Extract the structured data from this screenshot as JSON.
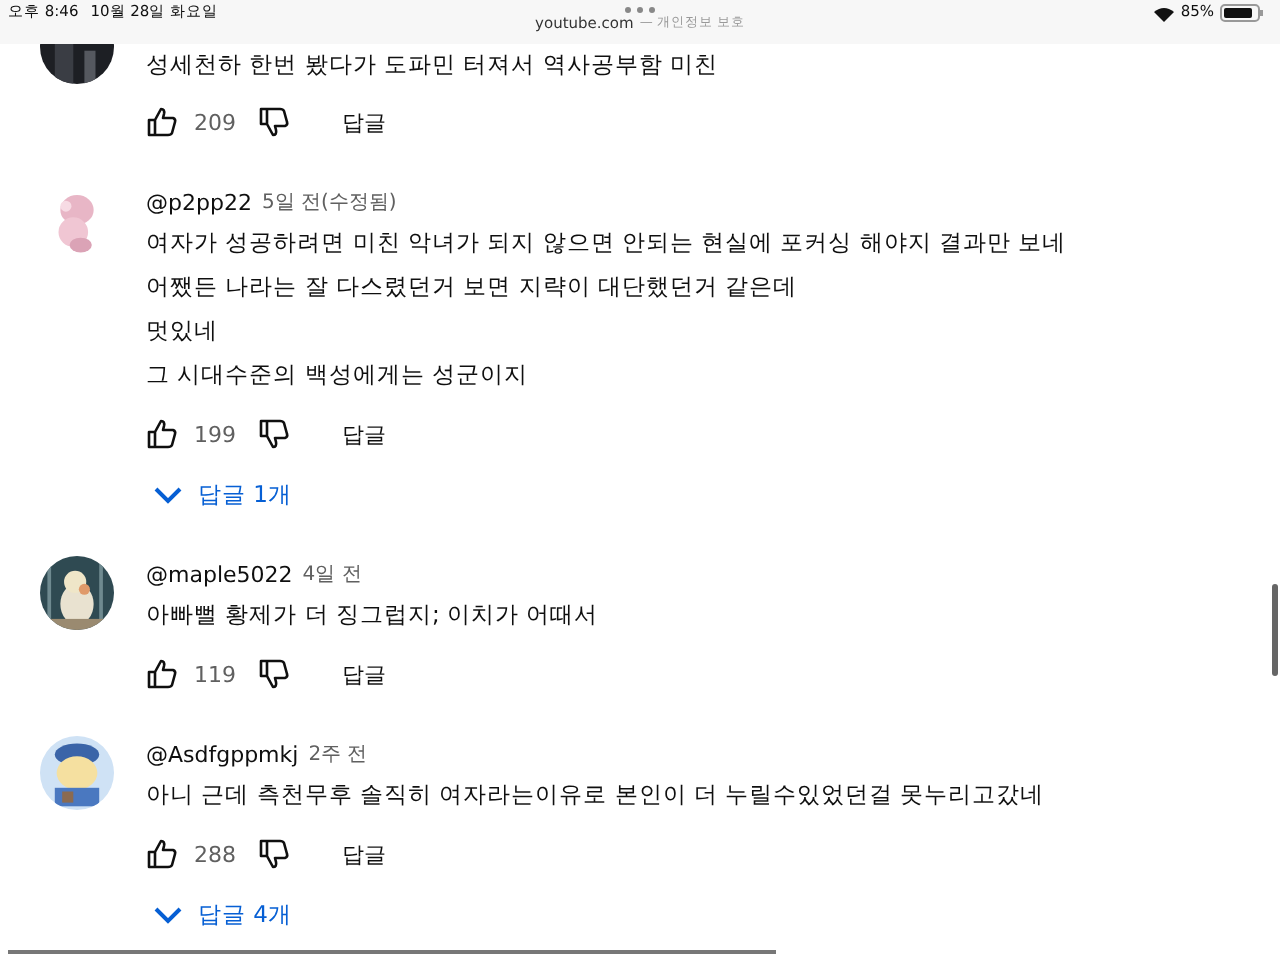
{
  "status_bar": {
    "time": "오후 8:46",
    "date": "10월 28일 화요일",
    "battery": "85%"
  },
  "address_bar": {
    "url": "youtube.com",
    "note": "— 개인정보 보호"
  },
  "comments": [
    {
      "lines": [
        "성세천하 한번 봤다가 도파민 터져서 역사공부함 미친"
      ],
      "likes": "209",
      "reply_label": "답글"
    },
    {
      "author": "@p2pp22",
      "time": "5일 전(수정됨)",
      "lines": [
        "여자가 성공하려면 미친 악녀가 되지 않으면 안되는 현실에 포커싱 해야지 결과만 보네",
        "어쨌든 나라는 잘 다스렸던거 보면 지략이 대단했던거 같은데",
        "멋있네",
        "그 시대수준의 백성에게는 성군이지"
      ],
      "likes": "199",
      "reply_label": "답글",
      "replies": "답글 1개"
    },
    {
      "author": "@maple5022",
      "time": "4일 전",
      "lines": [
        "아빠뻘 황제가 더 징그럽지; 이치가 어때서"
      ],
      "likes": "119",
      "reply_label": "답글"
    },
    {
      "author": "@Asdfgppmkj",
      "time": "2주 전",
      "lines": [
        "아니 근데 측천무후 솔직히 여자라는이유로 본인이 더 누릴수있었던걸 못누리고갔네"
      ],
      "likes": "288",
      "reply_label": "답글",
      "replies": "답글 4개"
    }
  ]
}
